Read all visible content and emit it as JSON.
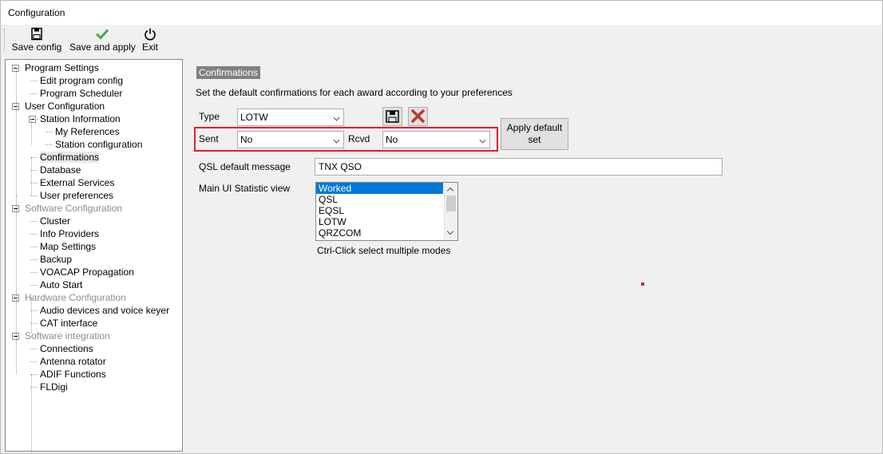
{
  "window": {
    "title": "Configuration"
  },
  "toolbar": {
    "save_config": "Save config",
    "save_and_apply": "Save and apply",
    "exit": "Exit"
  },
  "tree": [
    {
      "label": "Program Settings",
      "level": 0,
      "expander": true,
      "disabled": false
    },
    {
      "label": "Edit program config",
      "level": 1,
      "disabled": false
    },
    {
      "label": "Program Scheduler",
      "level": 1,
      "disabled": false
    },
    {
      "label": "User Configuration",
      "level": 0,
      "expander": true,
      "disabled": false
    },
    {
      "label": "Station Information",
      "level": 1,
      "expander": true,
      "disabled": false
    },
    {
      "label": "My References",
      "level": 2,
      "disabled": false
    },
    {
      "label": "Station configuration",
      "level": 2,
      "disabled": false
    },
    {
      "label": "Confirmations",
      "level": 1,
      "disabled": false,
      "selected": true
    },
    {
      "label": "Database",
      "level": 1,
      "disabled": false
    },
    {
      "label": "External Services",
      "level": 1,
      "disabled": false
    },
    {
      "label": "User preferences",
      "level": 1,
      "disabled": false
    },
    {
      "label": "Software Configuration",
      "level": 0,
      "expander": true,
      "disabled": true
    },
    {
      "label": "Cluster",
      "level": 1,
      "disabled": false
    },
    {
      "label": "Info Providers",
      "level": 1,
      "disabled": false
    },
    {
      "label": "Map Settings",
      "level": 1,
      "disabled": false
    },
    {
      "label": "Backup",
      "level": 1,
      "disabled": false
    },
    {
      "label": "VOACAP Propagation",
      "level": 1,
      "disabled": false
    },
    {
      "label": "Auto Start",
      "level": 1,
      "disabled": false
    },
    {
      "label": "Hardware Configuration",
      "level": 0,
      "expander": true,
      "disabled": true
    },
    {
      "label": "Audio devices and voice keyer",
      "level": 1,
      "disabled": false
    },
    {
      "label": "CAT interface",
      "level": 1,
      "disabled": false
    },
    {
      "label": "Software integration",
      "level": 0,
      "expander": true,
      "disabled": true
    },
    {
      "label": "Connections",
      "level": 1,
      "disabled": false
    },
    {
      "label": "Antenna rotator",
      "level": 1,
      "disabled": false
    },
    {
      "label": "ADIF Functions",
      "level": 1,
      "disabled": false
    },
    {
      "label": "FLDigi",
      "level": 1,
      "disabled": false
    }
  ],
  "panel": {
    "title": "Confirmations",
    "description": "Set the default confirmations for each award according to your preferences",
    "type_label": "Type",
    "type_value": "LOTW",
    "sent_label": "Sent",
    "sent_value": "No",
    "rcvd_label": "Rcvd",
    "rcvd_value": "No",
    "apply_default": "Apply default set",
    "qsl_label": "QSL default message",
    "qsl_value": "TNX QSO",
    "stat_label": "Main UI Statistic view",
    "stat_options": [
      "Worked",
      "QSL",
      "EQSL",
      "LOTW",
      "QRZCOM"
    ],
    "stat_selected": "Worked",
    "hint": "Ctrl-Click select multiple modes"
  },
  "colors": {
    "highlight": "#e01e2d",
    "selection": "#0078d7",
    "section_title_bg": "#808080",
    "save_check": "#3cb043"
  }
}
